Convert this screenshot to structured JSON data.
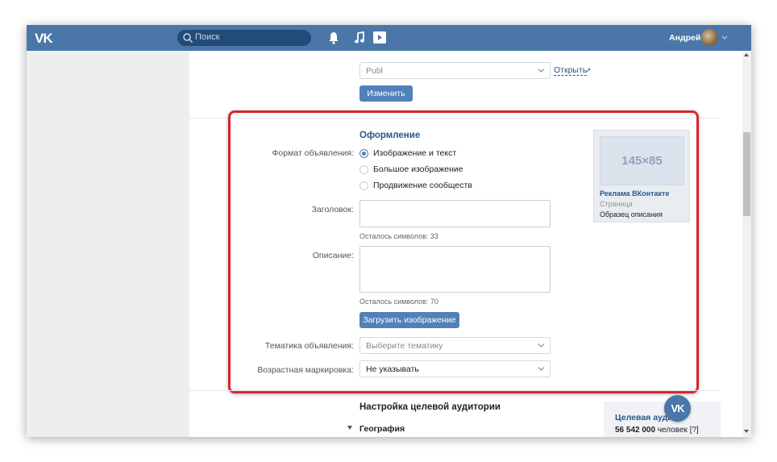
{
  "header": {
    "logo": "VK",
    "search_placeholder": "Поиск",
    "user_name": "Андрей"
  },
  "top_form": {
    "page_select_value": "Publ",
    "open_link": "Открыть",
    "change_button": "Изменить"
  },
  "design": {
    "title": "Оформление",
    "format_label": "Формат объявления:",
    "format_options": [
      {
        "label": "Изображение и текст",
        "selected": true
      },
      {
        "label": "Большое изображение",
        "selected": false
      },
      {
        "label": "Продвижение сообществ",
        "selected": false
      }
    ],
    "heading_label": "Заголовок:",
    "heading_hint": "Осталось символов: 33",
    "description_label": "Описание:",
    "description_hint": "Осталось символов: 70",
    "upload_button": "Загрузить изображение",
    "topic_label": "Тематика объявления:",
    "topic_placeholder": "Выберите тематику",
    "age_label": "Возрастная маркировка:",
    "age_value": "Не указывать"
  },
  "preview": {
    "image_size": "145×85",
    "title": "Реклама ВКонтакте",
    "type": "Страница",
    "description": "Образец описания"
  },
  "audience": {
    "title": "Настройка целевой аудитории",
    "geo_label": "География",
    "box_title": "Целевая аудит",
    "count": "56 542 000",
    "count_suffix": "человек [?]"
  },
  "colors": {
    "header": "#4a76a8",
    "button": "#5181b8",
    "link": "#2a5885",
    "highlight_frame": "#d8262b"
  }
}
